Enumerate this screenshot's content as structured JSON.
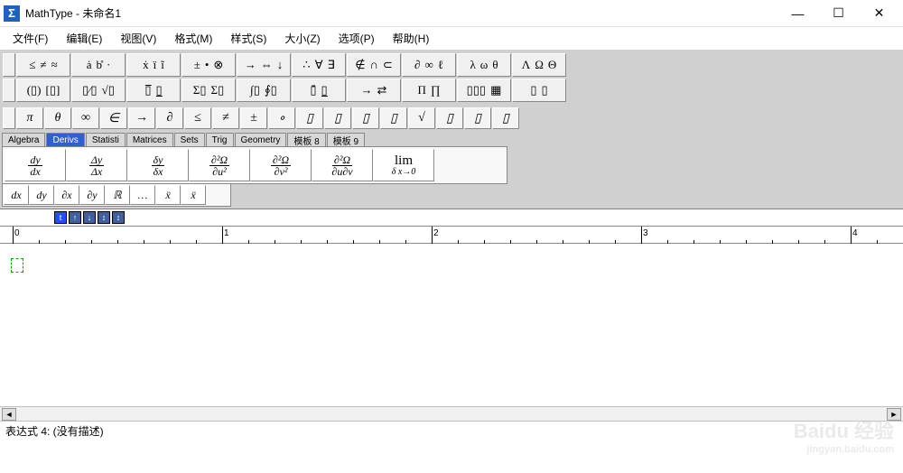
{
  "titlebar": {
    "app_icon": "Σ",
    "title": "MathType - 未命名1",
    "min": "—",
    "max": "☐",
    "close": "✕"
  },
  "menubar": [
    "文件(F)",
    "编辑(E)",
    "视图(V)",
    "格式(M)",
    "样式(S)",
    "大小(Z)",
    "选项(P)",
    "帮助(H)"
  ],
  "symbol_row1": [
    [
      "≤",
      "≠",
      "≈"
    ],
    [
      "ȧ",
      "b̊",
      "·"
    ],
    [
      "ẋ",
      "ï",
      "ĩ"
    ],
    [
      "±",
      "•",
      "⊗"
    ],
    [
      "→",
      "⇔",
      "↓"
    ],
    [
      "∴",
      "∀",
      "∃"
    ],
    [
      "∉",
      "∩",
      "⊂"
    ],
    [
      "∂",
      "∞",
      "ℓ"
    ],
    [
      "λ",
      "ω",
      "θ"
    ],
    [
      "Λ",
      "Ω",
      "Θ"
    ]
  ],
  "symbol_row2": [
    [
      "(▯)",
      "[▯]"
    ],
    [
      "▯⁄▯",
      "√▯"
    ],
    [
      "▯̅",
      "▯̲"
    ],
    [
      "Σ▯",
      "Σ▯"
    ],
    [
      "∫▯",
      "∮▯"
    ],
    [
      "▯̄",
      "▯̲"
    ],
    [
      "→",
      "⇄"
    ],
    [
      "Π",
      "∏"
    ],
    [
      "▯▯▯",
      "▦"
    ],
    [
      "▯",
      "▯"
    ]
  ],
  "constants": [
    "π",
    "θ",
    "∞",
    "∈",
    "→",
    "∂",
    "≤",
    "≠",
    "±",
    "∘",
    "▯",
    "▯",
    "▯",
    "▯",
    "√",
    "▯",
    "▯",
    "▯"
  ],
  "tabs": [
    {
      "label": "Algebra",
      "active": false
    },
    {
      "label": "Derivs",
      "active": true
    },
    {
      "label": "Statisti",
      "active": false
    },
    {
      "label": "Matrices",
      "active": false
    },
    {
      "label": "Sets",
      "active": false
    },
    {
      "label": "Trig",
      "active": false
    },
    {
      "label": "Geometry",
      "active": false
    },
    {
      "label": "模板 8",
      "active": false
    },
    {
      "label": "模板 9",
      "active": false
    }
  ],
  "derivs_row1": [
    {
      "n": "dy",
      "d": "dx"
    },
    {
      "n": "Δy",
      "d": "Δx"
    },
    {
      "n": "δy",
      "d": "δx"
    },
    {
      "n": "∂²Ω",
      "d": "∂u²"
    },
    {
      "n": "∂²Ω",
      "d": "∂v²"
    },
    {
      "n": "∂²Ω",
      "d": "∂u∂v"
    },
    {
      "type": "lim",
      "top": "lim",
      "bot": "δ x→0"
    }
  ],
  "derivs_row2": [
    "dx",
    "dy",
    "∂x",
    "∂y",
    "ℝ",
    "…",
    "ẍ",
    "ẍ"
  ],
  "tabstrip_icons": [
    "t",
    "↑",
    "↓",
    "↕",
    "↕"
  ],
  "ruler_marks": [
    "0",
    "1",
    "2",
    "3",
    "4"
  ],
  "scrollbar": {
    "left": "◄",
    "right": "►"
  },
  "status": "表达式 4:  (没有描述)",
  "watermark": {
    "main": "Baidu 经验",
    "sub": "jingyan.baidu.com"
  }
}
